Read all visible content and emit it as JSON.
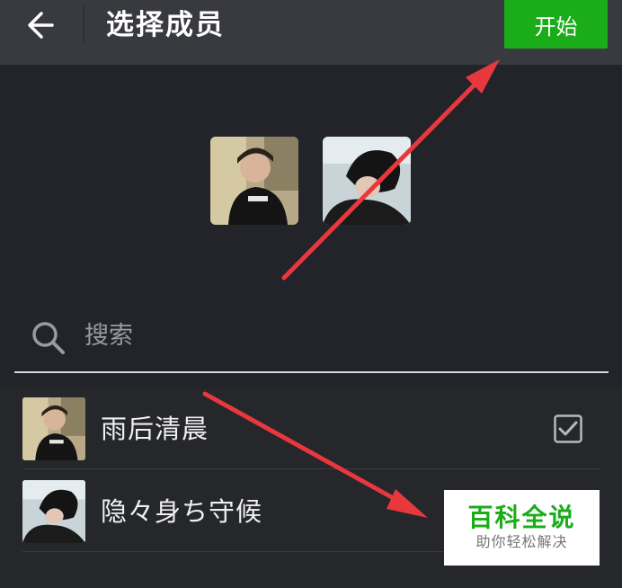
{
  "header": {
    "title": "选择成员",
    "start_button_label": "开始",
    "back_icon": "arrow-left-icon"
  },
  "selected_members": [
    {
      "name": "雨后清晨"
    },
    {
      "name": "隐々身ち守候"
    }
  ],
  "search": {
    "placeholder": "搜索",
    "icon": "search-icon"
  },
  "contacts": [
    {
      "name": "雨后清晨",
      "checked": true
    },
    {
      "name": "隐々身ち守候",
      "checked": false
    }
  ],
  "watermark": {
    "main": "百科全说",
    "sub": "助你轻松解决"
  },
  "colors": {
    "header_bg": "#393a3f",
    "page_bg": "#222429",
    "accent_green": "#1aad19",
    "arrow_red": "#e8383d"
  }
}
